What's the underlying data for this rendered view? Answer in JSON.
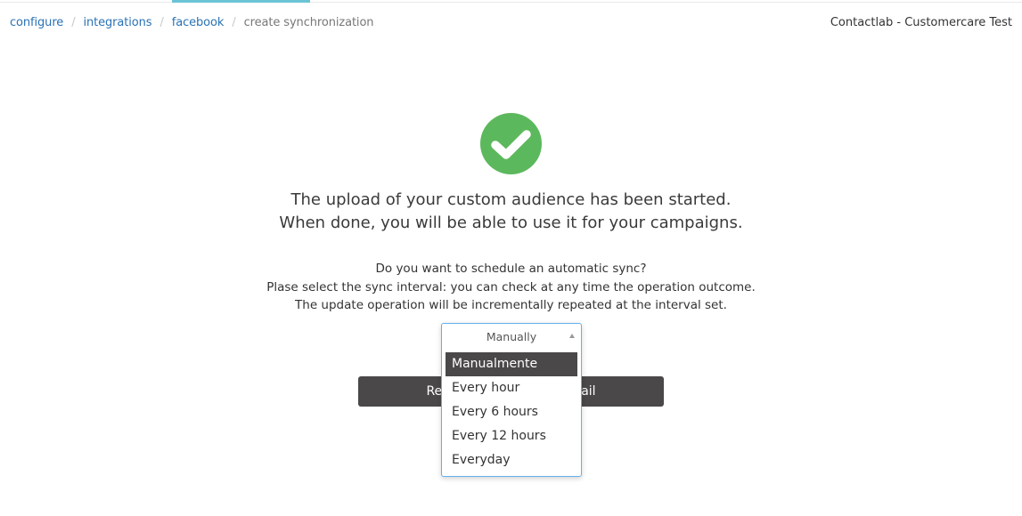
{
  "header": {
    "breadcrumb": [
      {
        "label": "configure",
        "link": true
      },
      {
        "label": "integrations",
        "link": true
      },
      {
        "label": "facebook",
        "link": true
      },
      {
        "label": "create synchronization",
        "link": false
      }
    ],
    "separator": "/",
    "account": "Contactlab - Customercare Test",
    "accent_color": "#6bc4d6"
  },
  "status": {
    "icon": "check-circle-icon",
    "icon_color": "#5cb85c",
    "message_line1": "The upload of your custom audience has been started.",
    "message_line2": "When done, you will be able to use it for your campaigns."
  },
  "schedule": {
    "question": "Do you want to schedule an automatic sync?",
    "instructions_line1": "Plase select the sync interval: you can check at any time the operation outcome.",
    "instructions_line2": "The update operation will be incrementally repeated at the interval set.",
    "select": {
      "current_value": "Manually",
      "expanded": true,
      "options": [
        {
          "label": "Manualmente",
          "highlighted": true
        },
        {
          "label": "Every hour",
          "highlighted": false
        },
        {
          "label": "Every 6 hours",
          "highlighted": false
        },
        {
          "label": "Every 12 hours",
          "highlighted": false
        },
        {
          "label": "Everyday",
          "highlighted": false
        }
      ]
    }
  },
  "actions": {
    "return_button_label": "Return to integration detail"
  }
}
